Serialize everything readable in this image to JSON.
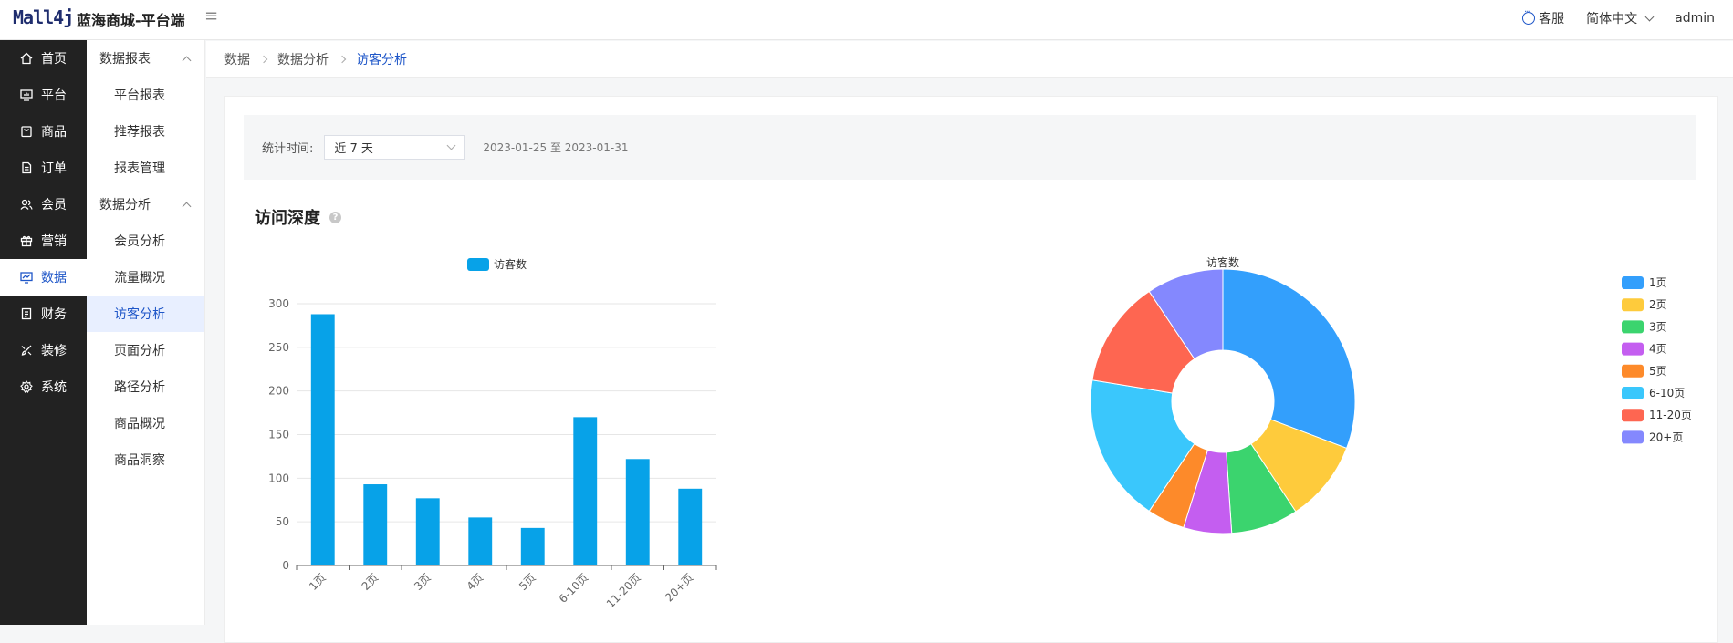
{
  "header": {
    "logo": "Mall4j",
    "app_title": "蓝海商城-平台端",
    "service": "客服",
    "language": "简体中文",
    "user": "admin"
  },
  "sidebar": {
    "items": [
      {
        "label": "首页",
        "icon": "home-icon"
      },
      {
        "label": "平台",
        "icon": "monitor-icon"
      },
      {
        "label": "商品",
        "icon": "bag-icon"
      },
      {
        "label": "订单",
        "icon": "document-icon"
      },
      {
        "label": "会员",
        "icon": "user-group-icon"
      },
      {
        "label": "营销",
        "icon": "gift-icon"
      },
      {
        "label": "数据",
        "icon": "chart-icon",
        "active": true
      },
      {
        "label": "财务",
        "icon": "ledger-icon"
      },
      {
        "label": "装修",
        "icon": "brush-icon"
      },
      {
        "label": "系统",
        "icon": "gear-icon"
      }
    ]
  },
  "submenu": {
    "group1": "数据报表",
    "group1_items": [
      "平台报表",
      "推荐报表",
      "报表管理"
    ],
    "group2": "数据分析",
    "group2_items": [
      "会员分析",
      "流量概况",
      "访客分析",
      "页面分析",
      "路径分析",
      "商品概况",
      "商品洞察"
    ],
    "active": "访客分析"
  },
  "breadcrumb": [
    "数据",
    "数据分析",
    "访客分析"
  ],
  "filter": {
    "label": "统计时间:",
    "selected": "近 7 天",
    "date_range": "2023-01-25 至 2023-01-31"
  },
  "section": {
    "title": "访问深度"
  },
  "colors": {
    "accent": "#1e56c8",
    "bar": "#07a2e8"
  },
  "chart_data": [
    {
      "type": "bar",
      "legend": [
        "访客数"
      ],
      "categories": [
        "1页",
        "2页",
        "3页",
        "4页",
        "5页",
        "6-10页",
        "11-20页",
        "20+页"
      ],
      "series": [
        {
          "name": "访客数",
          "values": [
            288,
            93,
            77,
            55,
            43,
            170,
            122,
            88
          ]
        }
      ],
      "ylim": [
        0,
        300
      ],
      "yticks": [
        0,
        50,
        100,
        150,
        200,
        250,
        300
      ],
      "grid": true,
      "legend_position": "top"
    },
    {
      "type": "pie",
      "title": "访客数",
      "donut": true,
      "categories": [
        "1页",
        "2页",
        "3页",
        "4页",
        "5页",
        "6-10页",
        "11-20页",
        "20+页"
      ],
      "values": [
        288,
        93,
        77,
        55,
        43,
        170,
        122,
        88
      ],
      "colors": [
        "#339ffc",
        "#fecb3c",
        "#3bd46e",
        "#c45ef0",
        "#fd8a2a",
        "#3ac7fc",
        "#fe6651",
        "#8488fe"
      ],
      "legend_position": "right"
    }
  ]
}
